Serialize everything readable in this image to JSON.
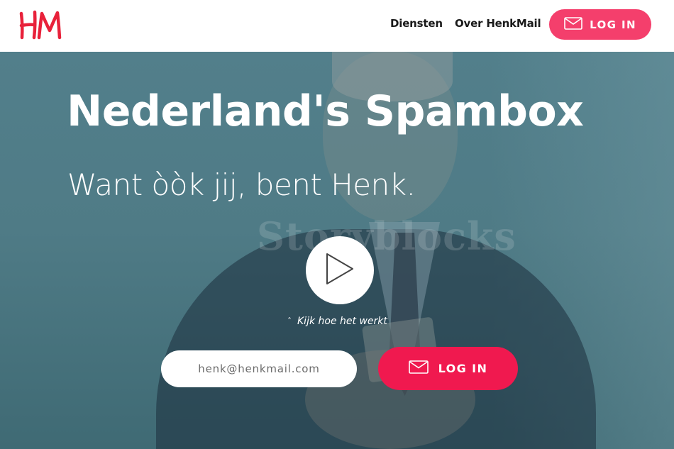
{
  "brand": {
    "logo_text": "HM",
    "logo_color": "#e8213a"
  },
  "nav": {
    "items": [
      {
        "label": "Diensten"
      },
      {
        "label": "Over HenkMail"
      }
    ],
    "login_label": "LOG IN",
    "login_icon": "envelope-icon"
  },
  "hero": {
    "title": "Nederland's Spambox",
    "subtitle": "Want òòk jij, bent Henk.",
    "watermark": "Storyblocks",
    "play_icon": "play-icon",
    "caption_caret": "ˆ",
    "caption": "Kijk hoe het werkt",
    "email_placeholder": "henk@henkmail.com",
    "login_label": "LOG IN",
    "login_icon": "envelope-icon"
  },
  "colors": {
    "accent": "#f43f6c",
    "accent_strong": "#f0194f",
    "hero_overlay": "#527f8b"
  }
}
